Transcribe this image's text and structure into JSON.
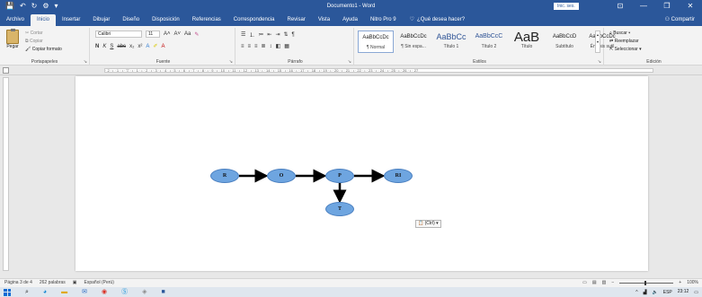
{
  "window": {
    "title": "Documento1 - Word",
    "signin_label": "Inic. ses.",
    "quick_access": [
      "💾",
      "↶",
      "↻",
      "⚙",
      "▾"
    ],
    "controls": [
      "⊡",
      "—",
      "❐",
      "✕"
    ]
  },
  "tabs": [
    {
      "label": "Archivo",
      "active": false
    },
    {
      "label": "Inicio",
      "active": true
    },
    {
      "label": "Insertar",
      "active": false
    },
    {
      "label": "Dibujar",
      "active": false
    },
    {
      "label": "Diseño",
      "active": false
    },
    {
      "label": "Disposición",
      "active": false
    },
    {
      "label": "Referencias",
      "active": false
    },
    {
      "label": "Correspondencia",
      "active": false
    },
    {
      "label": "Revisar",
      "active": false
    },
    {
      "label": "Vista",
      "active": false
    },
    {
      "label": "Ayuda",
      "active": false
    },
    {
      "label": "Nitro Pro 9",
      "active": false
    }
  ],
  "tellme": {
    "icon": "lightbulb-icon",
    "label": "¿Qué desea hacer?"
  },
  "share_label": "Compartir",
  "ribbon": {
    "clipboard": {
      "paste_label": "Pegar",
      "cut_label": "Cortar",
      "copy_label": "Copiar",
      "format_painter_label": "Copiar formato",
      "group_label": "Portapapeles"
    },
    "font": {
      "font_name": "Calibri",
      "font_size": "11",
      "group_label": "Fuente"
    },
    "paragraph": {
      "group_label": "Párrafo"
    },
    "styles": {
      "group_label": "Estilos",
      "items": [
        {
          "sample": "AaBbCcDc",
          "name": "¶ Normal",
          "kind": "n",
          "selected": true
        },
        {
          "sample": "AaBbCcDc",
          "name": "¶ Sin espa...",
          "kind": "n",
          "selected": false
        },
        {
          "sample": "AaBbCc",
          "name": "Título 1",
          "kind": "h1",
          "selected": false
        },
        {
          "sample": "AaBbCcC",
          "name": "Título 2",
          "kind": "h2",
          "selected": false
        },
        {
          "sample": "AaB",
          "name": "Título",
          "kind": "t",
          "selected": false
        },
        {
          "sample": "AaBbCcD",
          "name": "Subtítulo",
          "kind": "n",
          "selected": false
        },
        {
          "sample": "AaBbCcDc",
          "name": "Énfasis sutil",
          "kind": "n",
          "selected": false
        }
      ]
    },
    "editing": {
      "find_label": "Buscar",
      "replace_label": "Reemplazar",
      "select_label": "Seleccionar",
      "group_label": "Edición"
    }
  },
  "ruler_text": "· 2 · ı · 1 · ı · ▽ · ı · 1 · ı · 2 · ı · 3 · ı · 4 · ı · 5 · ı · 6 · ı · 7 · ı · 8 · ı · 9 · ı · 10 · ı · 11 · ı · 12 · ı · 13 · ı · 14 · ı · 15 · ı · 16 · ı · 17 · ı · 18 · ı · 19 · ı · 20 · ı · 21 · ı · 22 · ı · 23 · ı · 24 · ı · 25 · ı · 26 · ı · 27",
  "diagram": {
    "nodes": [
      {
        "id": "R",
        "label": "R"
      },
      {
        "id": "O",
        "label": "O"
      },
      {
        "id": "P",
        "label": "P"
      },
      {
        "id": "RI",
        "label": "RI"
      },
      {
        "id": "T",
        "label": "T"
      }
    ],
    "edges": [
      {
        "from": "R",
        "to": "O"
      },
      {
        "from": "O",
        "to": "P"
      },
      {
        "from": "P",
        "to": "RI"
      },
      {
        "from": "P",
        "to": "T"
      }
    ]
  },
  "paste_options_label": "(Ctrl) ▾",
  "status": {
    "page": "Página 3 de 4",
    "words": "262 palabras",
    "language": "Español (Perú)",
    "zoom": "100%"
  },
  "taskbar": {
    "apps": [
      "search-icon",
      "edge-icon",
      "folder-icon",
      "mail-icon",
      "chrome-icon",
      "skype-icon",
      "photos-icon",
      "word-icon"
    ],
    "language": "ESP",
    "time": "23:12"
  }
}
